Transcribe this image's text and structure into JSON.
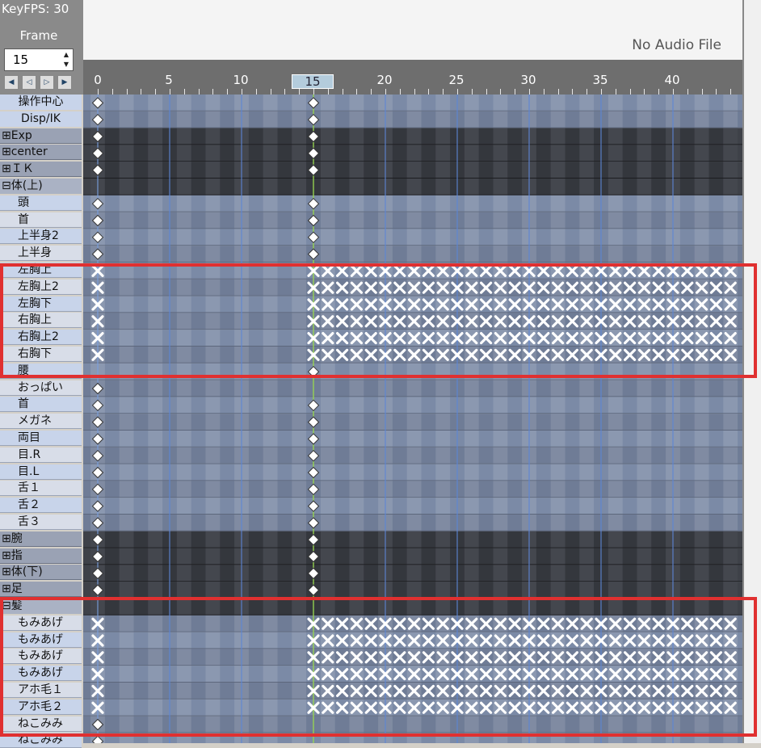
{
  "panel": {
    "keyfps_label": "KeyFPS: 30",
    "frame_label": "Frame",
    "frame_value": "15",
    "nav_buttons": [
      "◀",
      "◁",
      "▷",
      "▶"
    ]
  },
  "audio": {
    "status": "No Audio File"
  },
  "ruler": {
    "current_frame": "15",
    "labels": [
      "0",
      "5",
      "10",
      "20",
      "25",
      "30",
      "35",
      "40"
    ]
  },
  "highlight_color": "#e03030",
  "rows": [
    {
      "label": "操作中心",
      "kind": "top",
      "keys": "d0d15"
    },
    {
      "label": "Disp/IK",
      "kind": "top",
      "keys": "d0d15"
    },
    {
      "label": "⊞Exp",
      "kind": "group",
      "keys": "d0d15"
    },
    {
      "label": "⊞center",
      "kind": "group",
      "keys": "d0d15"
    },
    {
      "label": "⊞ＩＫ",
      "kind": "group",
      "keys": "d0d15"
    },
    {
      "label": "⊟体(上)",
      "kind": "open",
      "keys": ""
    },
    {
      "label": "頭",
      "kind": "bone",
      "keys": "d0d15"
    },
    {
      "label": "首",
      "kind": "bone",
      "keys": "d0d15"
    },
    {
      "label": "上半身2",
      "kind": "bone",
      "keys": "d0d15"
    },
    {
      "label": "上半身",
      "kind": "bone",
      "keys": "d0d15"
    },
    {
      "label": "左胸上",
      "kind": "bone",
      "keys": "x"
    },
    {
      "label": "左胸上2",
      "kind": "bone",
      "keys": "x"
    },
    {
      "label": "左胸下",
      "kind": "bone",
      "keys": "x"
    },
    {
      "label": "右胸上",
      "kind": "bone",
      "keys": "x"
    },
    {
      "label": "右胸上2",
      "kind": "bone",
      "keys": "x"
    },
    {
      "label": "右胸下",
      "kind": "bone",
      "keys": "x"
    },
    {
      "label": "腰",
      "kind": "bone",
      "keys": "d15"
    },
    {
      "label": "おっぱい",
      "kind": "bone",
      "keys": "d0"
    },
    {
      "label": "首",
      "kind": "bone",
      "keys": "d0d15"
    },
    {
      "label": "メガネ",
      "kind": "bone",
      "keys": "d0d15"
    },
    {
      "label": "両目",
      "kind": "bone",
      "keys": "d0d15"
    },
    {
      "label": "目.R",
      "kind": "bone",
      "keys": "d0d15"
    },
    {
      "label": "目.L",
      "kind": "bone",
      "keys": "d0d15"
    },
    {
      "label": "舌１",
      "kind": "bone",
      "keys": "d0d15"
    },
    {
      "label": "舌２",
      "kind": "bone",
      "keys": "d0d15"
    },
    {
      "label": "舌３",
      "kind": "bone",
      "keys": "d0d15"
    },
    {
      "label": "⊞腕",
      "kind": "group",
      "keys": "d0d15"
    },
    {
      "label": "⊞指",
      "kind": "group",
      "keys": "d0d15"
    },
    {
      "label": "⊞体(下)",
      "kind": "group",
      "keys": "d0d15"
    },
    {
      "label": "⊞足",
      "kind": "group",
      "keys": "d0d15"
    },
    {
      "label": "⊟髪",
      "kind": "open",
      "keys": ""
    },
    {
      "label": "もみあげ",
      "kind": "bone",
      "keys": "x"
    },
    {
      "label": "もみあげ",
      "kind": "bone",
      "keys": "x"
    },
    {
      "label": "もみあげ",
      "kind": "bone",
      "keys": "x"
    },
    {
      "label": "もみあげ",
      "kind": "bone",
      "keys": "x"
    },
    {
      "label": "アホ毛１",
      "kind": "bone",
      "keys": "x"
    },
    {
      "label": "アホ毛２",
      "kind": "bone",
      "keys": "x"
    },
    {
      "label": "ねこみみ",
      "kind": "bone",
      "keys": "d0"
    },
    {
      "label": "ねこみみ",
      "kind": "bone",
      "keys": "d0"
    }
  ]
}
